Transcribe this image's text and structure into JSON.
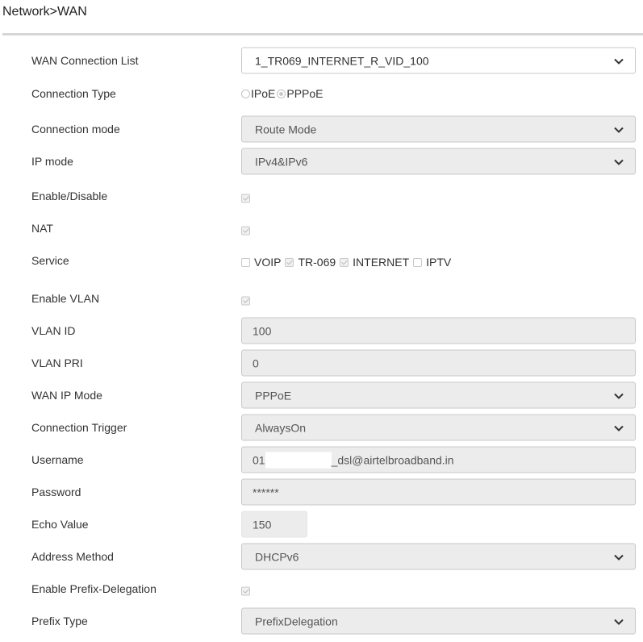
{
  "breadcrumb": "Network>WAN",
  "wan_connection_list": {
    "label": "WAN Connection List",
    "value": "1_TR069_INTERNET_R_VID_100"
  },
  "connection_type": {
    "label": "Connection Type",
    "options": [
      "IPoE",
      "PPPoE"
    ],
    "selected": "PPPoE"
  },
  "connection_mode": {
    "label": "Connection mode",
    "value": "Route Mode"
  },
  "ip_mode": {
    "label": "IP mode",
    "value": "IPv4&IPv6"
  },
  "enable_disable": {
    "label": "Enable/Disable",
    "checked": true
  },
  "nat": {
    "label": "NAT",
    "checked": true
  },
  "service": {
    "label": "Service",
    "items": [
      {
        "name": "VOIP",
        "checked": false
      },
      {
        "name": "TR-069",
        "checked": true
      },
      {
        "name": "INTERNET",
        "checked": true
      },
      {
        "name": "IPTV",
        "checked": false
      }
    ]
  },
  "enable_vlan": {
    "label": "Enable VLAN",
    "checked": true
  },
  "vlan_id": {
    "label": "VLAN ID",
    "value": "100"
  },
  "vlan_pri": {
    "label": "VLAN PRI",
    "value": "0"
  },
  "wan_ip_mode": {
    "label": "WAN IP Mode",
    "value": "PPPoE"
  },
  "connection_trigger": {
    "label": "Connection Trigger",
    "value": "AlwaysOn"
  },
  "username": {
    "label": "Username",
    "prefix": "01",
    "suffix": "_dsl@airtelbroadband.in"
  },
  "password": {
    "label": "Password",
    "value": "******"
  },
  "echo_value": {
    "label": "Echo Value",
    "value": "150"
  },
  "address_method": {
    "label": "Address Method",
    "value": "DHCPv6"
  },
  "enable_prefix_delegation": {
    "label": "Enable Prefix-Delegation",
    "checked": true
  },
  "prefix_type": {
    "label": "Prefix Type",
    "value": "PrefixDelegation"
  }
}
